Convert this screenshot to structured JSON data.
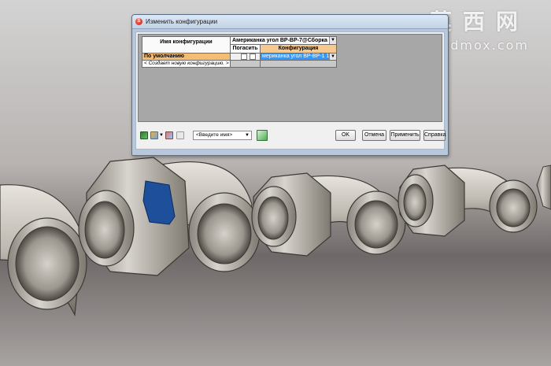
{
  "dialog": {
    "title": "Изменить конфигурации",
    "app_icon_letter": "S"
  },
  "table": {
    "name_header": "Имя конфигурации",
    "assembly_header": "Американка угол ВР-ВР-7@Сборка",
    "suppress_header": "Погасить",
    "config_header": "Конфигурация",
    "rows": [
      {
        "name": "По умолчанию",
        "config_value": "мериканка угол ВР-ВР-1 1\\4"
      },
      {
        "name": "< Создает новую конфигурацию. >"
      }
    ]
  },
  "toolbar": {
    "search_placeholder": "<Введите имя>",
    "ok_label": "OK",
    "cancel_label": "Отмена",
    "apply_label": "Применить",
    "help_label": "Справка"
  },
  "watermark": {
    "text_cn": "莫西网",
    "url": "www.3dmox.com"
  },
  "colors": {
    "header_orange": "#f6c98e",
    "selected_row": "#f5bd73",
    "selection_blue": "#3399ff",
    "highlighted_nut": "#1e4f9a",
    "fitting_metal": "#bdb8b0"
  }
}
